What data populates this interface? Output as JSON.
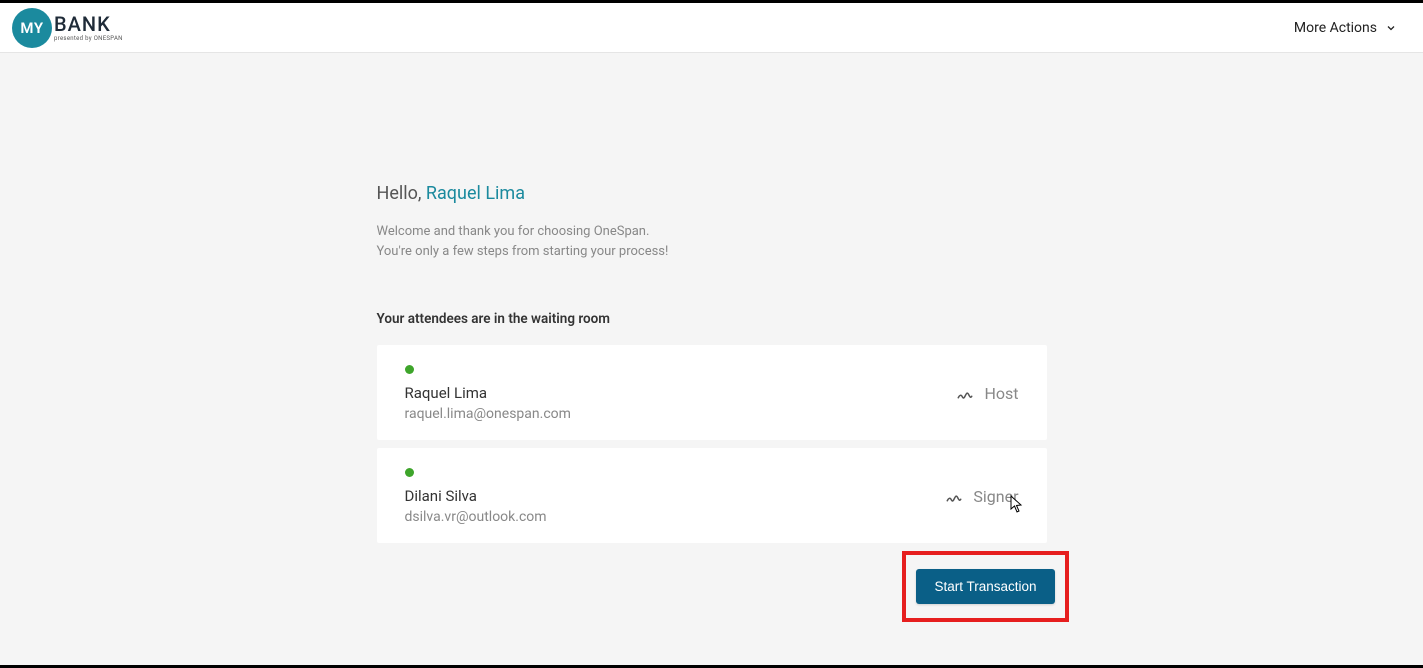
{
  "header": {
    "logo_circle": "MY",
    "logo_text": "BANK",
    "logo_sub": "presented by ONESPAN",
    "more_actions": "More Actions"
  },
  "greeting": {
    "hello": "Hello, ",
    "name": "Raquel Lima"
  },
  "welcome": {
    "line1": "Welcome and thank you for choosing OneSpan.",
    "line2": "You're only a few steps from starting your process!"
  },
  "waiting_title": "Your attendees are in the waiting room",
  "attendees": [
    {
      "name": "Raquel Lima",
      "email": "raquel.lima@onespan.com",
      "role": "Host"
    },
    {
      "name": "Dilani Silva",
      "email": "dsilva.vr@outlook.com",
      "role": "Signer"
    }
  ],
  "actions": {
    "start_transaction": "Start Transaction"
  }
}
